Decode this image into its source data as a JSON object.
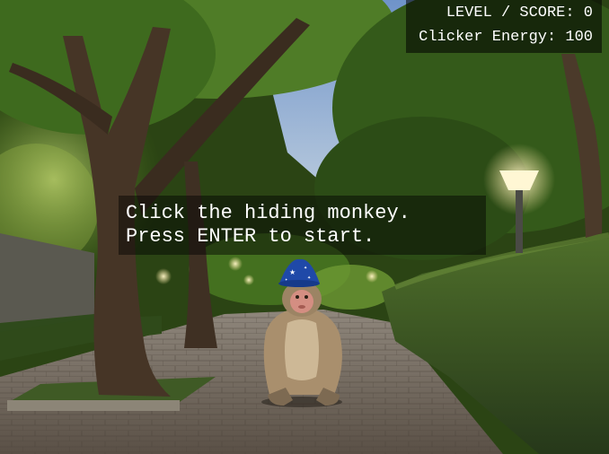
{
  "hud": {
    "level_score_label": "LEVEL / SCORE",
    "level_score_value": "0",
    "energy_label": "Clicker Energy",
    "energy_value": "100"
  },
  "message": {
    "line1": "Click the hiding monkey.",
    "line2": "Press ENTER to start."
  },
  "scene_objects": {
    "monkey_icon": "macaque-wizard-hat",
    "lamp_icon": "park-lamp"
  },
  "colors": {
    "text": "#ffffff",
    "foliage": "#3f6a23",
    "hedge": "#37511d",
    "path": "#6d6357",
    "hat": "#1f49a8"
  }
}
